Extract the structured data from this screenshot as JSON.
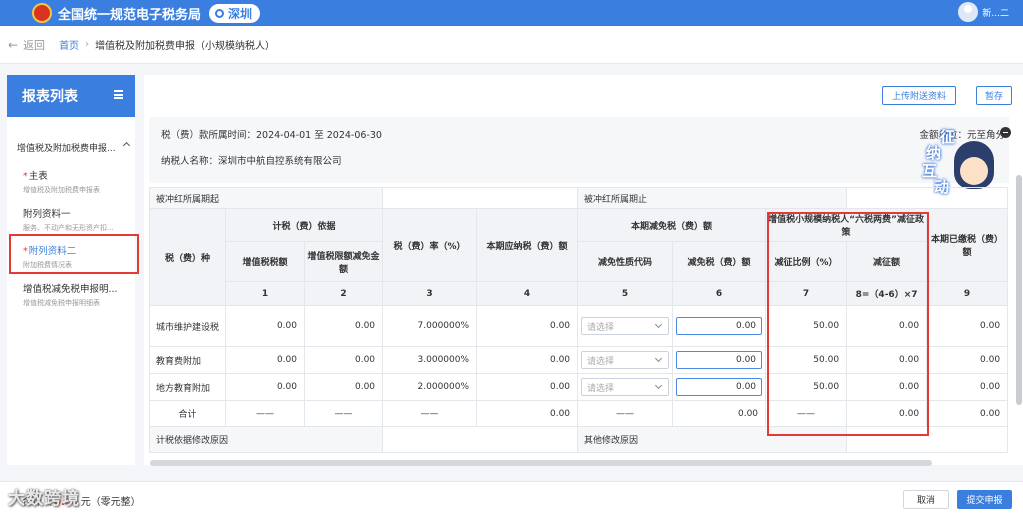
{
  "header": {
    "app_title": "全国统一规范电子税务局",
    "city": "深圳",
    "user_name": "新...二"
  },
  "breadcrumb": {
    "back_label": "返回",
    "home": "首页",
    "separator": "›",
    "current": "增值税及附加税费申报（小规模纳税人）"
  },
  "sidebar": {
    "title": "报表列表",
    "group_label": "增值税及附加税费申报...",
    "items": [
      {
        "label": "主表",
        "sub": "增值税及附加税费申报表",
        "required": true
      },
      {
        "label": "附列资料一",
        "sub": "服务、不动产和无形资产扣...",
        "required": false
      },
      {
        "label": "附列资料二",
        "sub": "附加税费情况表",
        "required": true
      },
      {
        "label": "增值税减免税申报明...",
        "sub": "增值税减免税申报明细表",
        "required": false
      }
    ]
  },
  "toolbar": {
    "upload_label": "上传附送资料",
    "save_label": "暂存"
  },
  "info": {
    "period_text": "税（费）款所属时间：2024-04-01 至 2024-06-30",
    "taxpayer_text": "纳税人名称：深圳市中航自控系统有限公司",
    "unit_text": "金额单位：元至角分"
  },
  "mascot": {
    "line1": "征",
    "line2": "纳",
    "line3": "互",
    "line4": "动"
  },
  "table": {
    "offset_start_label": "被冲红所属期起",
    "offset_end_label": "被冲红所属期止",
    "headers": {
      "tax_type": "税（费）种",
      "basis": "计税（费）依据",
      "vat_amount": "增值税税额",
      "vat_credit_reduction": "增值税限额减免金额",
      "rate": "税（费）率（%）",
      "payable": "本期应纳税（费）额",
      "reduction": "本期减免税（费）额",
      "reduction_code": "减免性质代码",
      "reduction_amount": "减免税（费）额",
      "policy": "增值税小规模纳税人“六税两费”减征政策",
      "policy_ratio": "减征比例（%）",
      "policy_amount": "减征额",
      "paid": "本期已缴税（费）额"
    },
    "column_numbers": [
      "1",
      "2",
      "3",
      "4",
      "5",
      "6",
      "7",
      "8=（4-6）×7",
      "9"
    ],
    "rows": [
      {
        "name": "城市维护建设税",
        "vat": "0.00",
        "credit": "0.00",
        "rate": "7.000000%",
        "payable": "0.00",
        "code_placeholder": "请选择",
        "reduction": "0.00",
        "ratio": "50.00",
        "policy_amount": "0.00",
        "paid": "0.00"
      },
      {
        "name": "教育费附加",
        "vat": "0.00",
        "credit": "0.00",
        "rate": "3.000000%",
        "payable": "0.00",
        "code_placeholder": "请选择",
        "reduction": "0.00",
        "ratio": "50.00",
        "policy_amount": "0.00",
        "paid": "0.00"
      },
      {
        "name": "地方教育附加",
        "vat": "0.00",
        "credit": "0.00",
        "rate": "2.000000%",
        "payable": "0.00",
        "code_placeholder": "请选择",
        "reduction": "0.00",
        "ratio": "50.00",
        "policy_amount": "0.00",
        "paid": "0.00"
      }
    ],
    "total": {
      "label": "合计",
      "dash": "——",
      "payable": "0.00",
      "reduction": "0.00",
      "policy_amount": "0.00",
      "paid": "0.00"
    },
    "basis_reason_label": "计税依据修改原因",
    "other_reason_label": "其他修改原因"
  },
  "footer": {
    "total_prefix": "合计（",
    "total_amount": "0.00",
    "total_suffix": "元（零元整）",
    "watermark": "大数跨境",
    "cancel_label": "取消",
    "submit_label": "提交申报"
  }
}
